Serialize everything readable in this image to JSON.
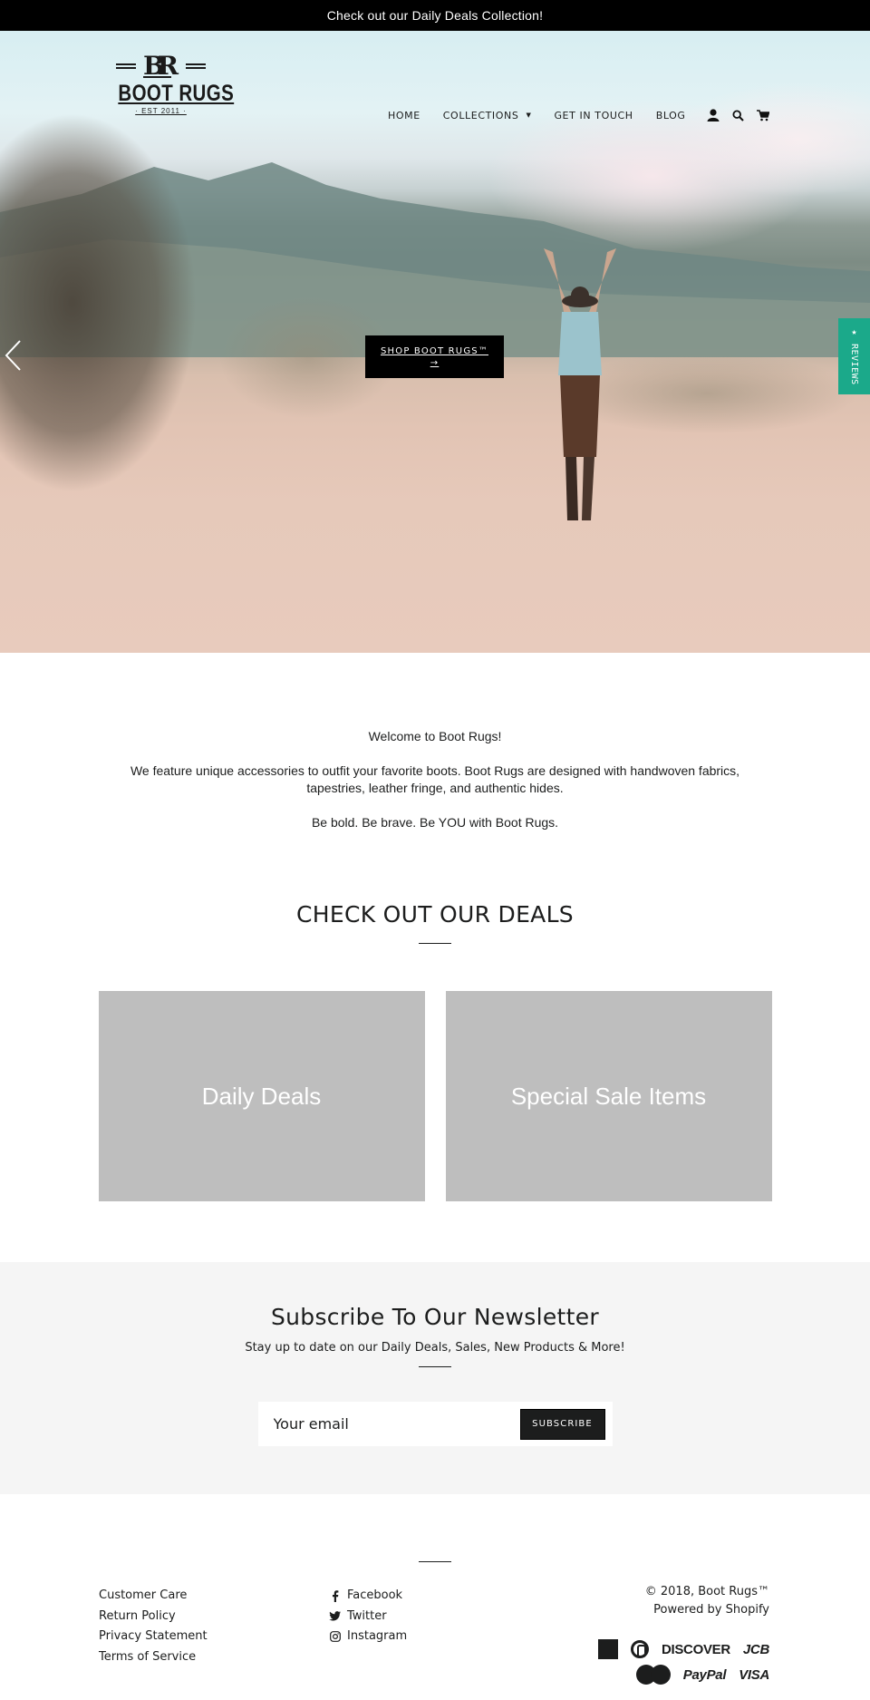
{
  "announcement": {
    "text": "Check out our Daily Deals Collection!"
  },
  "header": {
    "logo": {
      "monogram": "BR",
      "name": "BOOT RUGS",
      "tagline": "· EST 2011 ·"
    },
    "nav": [
      {
        "label": "HOME",
        "has_dropdown": false
      },
      {
        "label": "COLLECTIONS",
        "has_dropdown": true
      },
      {
        "label": "GET IN TOUCH",
        "has_dropdown": false
      },
      {
        "label": "BLOG",
        "has_dropdown": false
      }
    ],
    "icons": [
      "account-icon",
      "search-icon",
      "cart-icon"
    ]
  },
  "hero": {
    "button_label": "SHOP BOOT RUGS™",
    "button_arrow": "→",
    "prev_icon": "chevron-left-icon",
    "slides_total": 5,
    "active_slide": 1
  },
  "reviews_tab": {
    "label": "★ REVIEWS",
    "color": "#1ba98a"
  },
  "welcome": {
    "heading": "Welcome to Boot Rugs!",
    "body": "We feature unique accessories to outfit your favorite boots. Boot Rugs are designed with handwoven fabrics, tapestries, leather fringe, and authentic hides.",
    "tagline": "Be bold. Be brave. Be YOU with Boot Rugs."
  },
  "deals": {
    "title": "CHECK OUT OUR DEALS",
    "cards": [
      {
        "label": "Daily Deals"
      },
      {
        "label": "Special Sale Items"
      }
    ]
  },
  "newsletter": {
    "title": "Subscribe To Our Newsletter",
    "subtitle": "Stay up to date on our Daily Deals, Sales, New Products & More!",
    "email_placeholder": "Your email",
    "email_value": "",
    "button_label": "SUBSCRIBE"
  },
  "footer": {
    "links": [
      "Customer Care",
      "Return Policy",
      "Privacy Statement",
      "Terms of Service"
    ],
    "social": [
      {
        "label": "Facebook",
        "icon": "facebook-icon"
      },
      {
        "label": "Twitter",
        "icon": "twitter-icon"
      },
      {
        "label": "Instagram",
        "icon": "instagram-icon"
      }
    ],
    "copyright": "© 2018, Boot Rugs™",
    "powered_by": "Powered by Shopify",
    "payments": [
      "American Express",
      "Diners Club",
      "DISCOVER",
      "JCB",
      "MasterCard",
      "PayPal",
      "VISA"
    ]
  }
}
